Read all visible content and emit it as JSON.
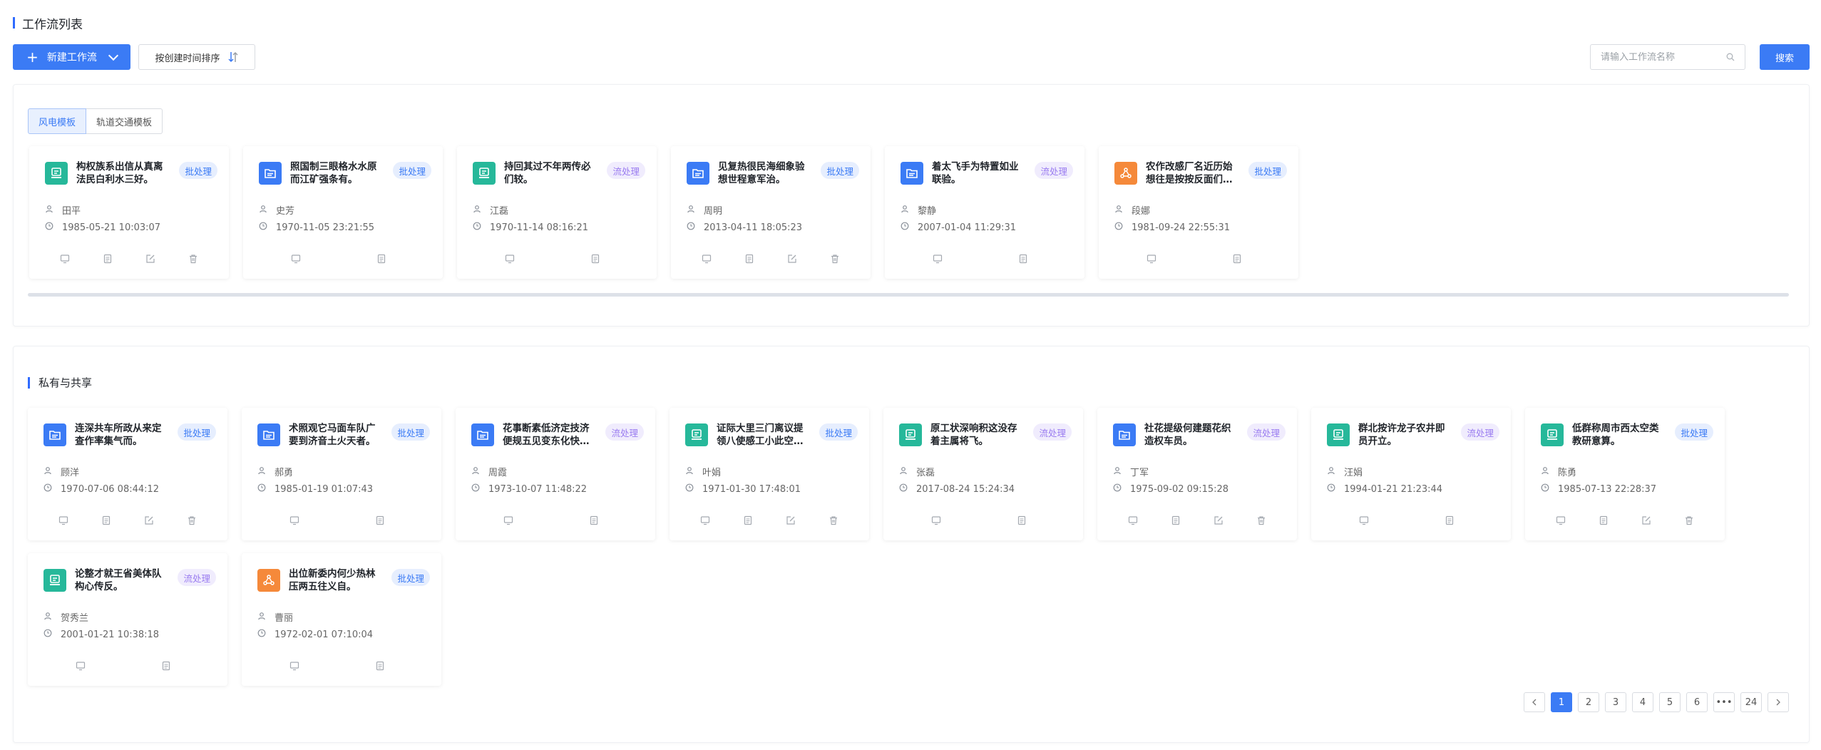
{
  "header": {
    "title": "工作流列表"
  },
  "toolbar": {
    "new_label": "新建工作流",
    "sort_label": "按创建时间排序",
    "search_placeholder": "请输入工作流名称",
    "search_label": "搜索"
  },
  "templates": {
    "tabs": [
      {
        "label": "风电模板",
        "active": true
      },
      {
        "label": "轨道交通模板",
        "active": false
      }
    ],
    "cards": [
      {
        "icon": "teal",
        "name": "构权族系出信从真离法民白利水三好。",
        "tag": "批处理",
        "tag_type": "batch",
        "user": "田平",
        "time": "1985-05-21 10:03:07",
        "actions": 4
      },
      {
        "icon": "blue",
        "name": "照国制三眼格水水原而江矿强条有。",
        "tag": "批处理",
        "tag_type": "batch",
        "user": "史芳",
        "time": "1970-11-05 23:21:55",
        "actions": 2
      },
      {
        "icon": "teal",
        "name": "持回其过不年两传必们较。",
        "tag": "流处理",
        "tag_type": "flow",
        "user": "江磊",
        "time": "1970-11-14 08:16:21",
        "actions": 2
      },
      {
        "icon": "blue",
        "name": "见复热很民海细象验想世程意军治。",
        "tag": "批处理",
        "tag_type": "batch",
        "user": "周明",
        "time": "2013-04-11 18:05:23",
        "actions": 4
      },
      {
        "icon": "blue",
        "name": "着太飞手为特置如业联验。",
        "tag": "流处理",
        "tag_type": "flow",
        "user": "黎静",
        "time": "2007-01-04 11:29:31",
        "actions": 2
      },
      {
        "icon": "orange",
        "name": "农作改感厂名近历始想往是按按反面们…",
        "tag": "批处理",
        "tag_type": "batch",
        "user": "段娜",
        "time": "1981-09-24 22:55:31",
        "actions": 2
      }
    ]
  },
  "shared": {
    "title": "私有与共享",
    "cards": [
      {
        "icon": "blue",
        "name": "连深共车所政从来定查作率集气而。",
        "tag": "批处理",
        "tag_type": "batch",
        "user": "顾洋",
        "time": "1970-07-06 08:44:12",
        "actions": 4
      },
      {
        "icon": "blue",
        "name": "术照观它马面车队广要到济音土火天者。",
        "tag": "批处理",
        "tag_type": "batch",
        "user": "郝勇",
        "time": "1985-01-19 01:07:43",
        "actions": 2
      },
      {
        "icon": "blue",
        "name": "花事断素低济定技济便规五见变东化快…",
        "tag": "流处理",
        "tag_type": "flow",
        "user": "周霞",
        "time": "1973-10-07 11:48:22",
        "actions": 2
      },
      {
        "icon": "teal",
        "name": "证际大里三门离议提领八使感工小此空…",
        "tag": "批处理",
        "tag_type": "batch",
        "user": "叶娟",
        "time": "1971-01-30 17:48:01",
        "actions": 4
      },
      {
        "icon": "teal",
        "name": "原工状深响积这没存着主属将飞。",
        "tag": "流处理",
        "tag_type": "flow",
        "user": "张磊",
        "time": "2017-08-24 15:24:34",
        "actions": 2
      },
      {
        "icon": "blue",
        "name": "社花提级何建题花织造权车员。",
        "tag": "流处理",
        "tag_type": "flow",
        "user": "丁军",
        "time": "1975-09-02 09:15:28",
        "actions": 4
      },
      {
        "icon": "teal",
        "name": "群北按许龙子农井即员开立。",
        "tag": "流处理",
        "tag_type": "flow",
        "user": "汪娟",
        "time": "1994-01-21 21:23:44",
        "actions": 2
      },
      {
        "icon": "teal",
        "name": "低群称周市西太空类教研意算。",
        "tag": "批处理",
        "tag_type": "batch",
        "user": "陈勇",
        "time": "1985-07-13 22:28:37",
        "actions": 4
      },
      {
        "icon": "teal",
        "name": "论整才就王省美体队构心传反。",
        "tag": "流处理",
        "tag_type": "flow",
        "user": "贺秀兰",
        "time": "2001-01-21 10:38:18",
        "actions": 2
      },
      {
        "icon": "orange",
        "name": "出位新委内何少热林压两五往义自。",
        "tag": "批处理",
        "tag_type": "batch",
        "user": "曹丽",
        "time": "1972-02-01 07:10:04",
        "actions": 2
      }
    ]
  },
  "pagination": {
    "pages": [
      "1",
      "2",
      "3",
      "4",
      "5",
      "6",
      "•••",
      "24"
    ],
    "current": "1"
  },
  "colors": {
    "accent": "#3b7bf5",
    "teal": "#26b89a",
    "orange": "#f5893a",
    "batch_tag": "#3b7bf5",
    "flow_tag": "#9a7cf0"
  }
}
